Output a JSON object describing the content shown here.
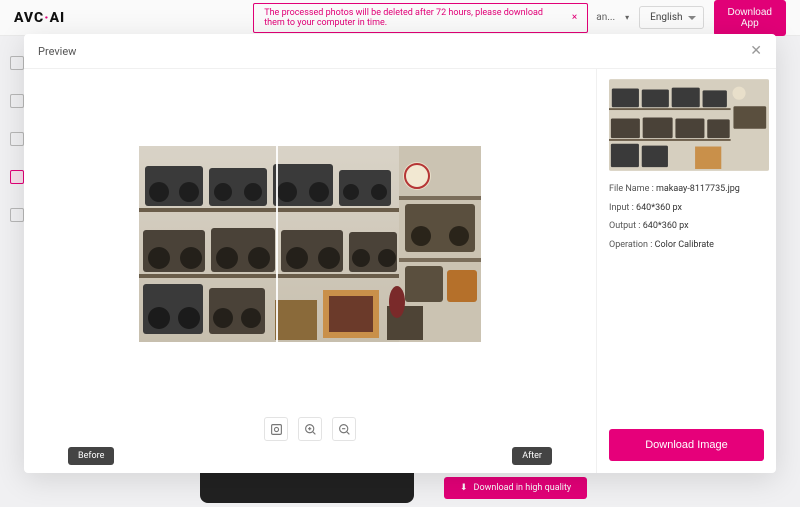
{
  "logo": {
    "part1": "AVC",
    "part2": "AI"
  },
  "banner": {
    "text": "The processed photos will be deleted after 72 hours, please download them to your computer in time."
  },
  "nav_fragment": "an...",
  "language": {
    "selected": "English"
  },
  "download_app": "Download App",
  "modal": {
    "title": "Preview",
    "before": "Before",
    "after": "After",
    "download": "Download Image"
  },
  "meta": {
    "filename_label": "File Name :",
    "filename": "makaay-8117735.jpg",
    "input_label": "Input :",
    "input": "640*360 px",
    "output_label": "Output :",
    "output": "640*360 px",
    "operation_label": "Operation :",
    "operation": "Color Calibrate"
  },
  "bg": {
    "download_hq": "Download in high quality"
  }
}
